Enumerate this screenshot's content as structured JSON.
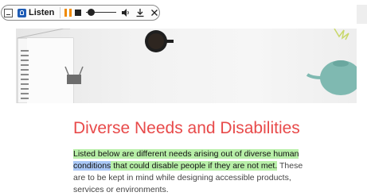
{
  "toolbar": {
    "listen_label": "Listen",
    "progress_fraction": 0.15,
    "accent_color": "#f08a00",
    "icons": [
      "menu-toggle-icon",
      "listen-icon",
      "pause-icon",
      "stop-icon",
      "volume-icon",
      "download-icon",
      "close-icon"
    ]
  },
  "page": {
    "heading": "Diverse Needs and Disabilities",
    "heading_color": "#e84a4a",
    "intro": {
      "highlight_1": "Listed below are different needs arising out of diverse human ",
      "current_word": "conditions",
      "highlight_2": " that could disable people if they are not met.",
      "rest": " These are to be kept in mind while designing accessible products, services or environments.",
      "highlight_color": "#b8efa8",
      "current_word_color": "#a9c7f5"
    }
  }
}
